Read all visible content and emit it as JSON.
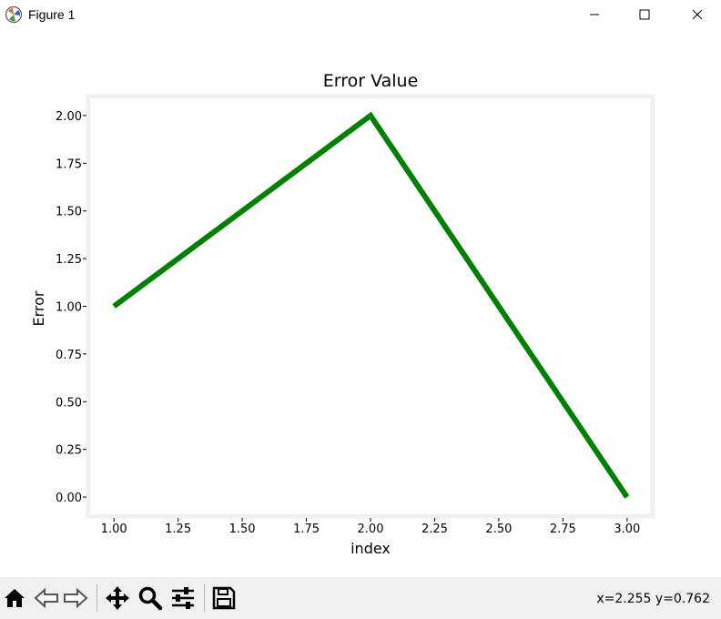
{
  "window": {
    "title": "Figure 1"
  },
  "toolbar": {
    "buttons": [
      "home-icon",
      "back-icon",
      "forward-icon",
      "pan-icon",
      "zoom-icon",
      "configure-icon",
      "save-icon"
    ],
    "coords": "x=2.255 y=0.762"
  },
  "colors": {
    "line": "#008000",
    "frame": "#f0f0f0"
  },
  "chart_data": {
    "type": "line",
    "title": "Error Value",
    "xlabel": "index",
    "ylabel": "Error",
    "x": [
      1.0,
      2.0,
      3.0
    ],
    "series": [
      {
        "values": [
          1.0,
          2.0,
          0.0
        ]
      }
    ],
    "xlim": [
      0.9,
      3.1
    ],
    "ylim": [
      -0.1,
      2.1
    ],
    "xticks": [
      "1.00",
      "1.25",
      "1.50",
      "1.75",
      "2.00",
      "2.25",
      "2.50",
      "2.75",
      "3.00"
    ],
    "yticks": [
      "0.00",
      "0.25",
      "0.50",
      "0.75",
      "1.00",
      "1.25",
      "1.50",
      "1.75",
      "2.00"
    ],
    "grid": false
  }
}
